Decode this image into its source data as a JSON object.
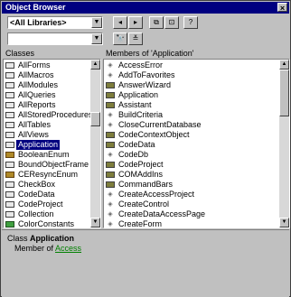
{
  "window": {
    "title": "Object Browser",
    "close_glyph": "×"
  },
  "toolbar": {
    "library_value": "<All Libraries>",
    "search_value": "",
    "buttons": [
      {
        "name": "back-button",
        "glyph": "◂"
      },
      {
        "name": "forward-button",
        "glyph": "▸"
      },
      {
        "name": "copy-to-clipboard-button",
        "glyph": "⧉"
      },
      {
        "name": "view-definition-button",
        "glyph": "⊡"
      },
      {
        "name": "help-button",
        "glyph": "?"
      }
    ],
    "search_button_glyph": "🔭",
    "toggle_results_glyph": "≚"
  },
  "classes": {
    "header": "Classes",
    "items": [
      {
        "label": "AllForms",
        "icon": "class"
      },
      {
        "label": "AllMacros",
        "icon": "class"
      },
      {
        "label": "AllModules",
        "icon": "class"
      },
      {
        "label": "AllQueries",
        "icon": "class"
      },
      {
        "label": "AllReports",
        "icon": "class"
      },
      {
        "label": "AllStoredProcedures",
        "icon": "class"
      },
      {
        "label": "AllTables",
        "icon": "class"
      },
      {
        "label": "AllViews",
        "icon": "class"
      },
      {
        "label": "Application",
        "icon": "class",
        "selected": true
      },
      {
        "label": "BooleanEnum",
        "icon": "enum"
      },
      {
        "label": "BoundObjectFrame",
        "icon": "class"
      },
      {
        "label": "CEResyncEnum",
        "icon": "enum"
      },
      {
        "label": "CheckBox",
        "icon": "class"
      },
      {
        "label": "CodeData",
        "icon": "class"
      },
      {
        "label": "CodeProject",
        "icon": "class"
      },
      {
        "label": "Collection",
        "icon": "class"
      },
      {
        "label": "ColorConstants",
        "icon": "module"
      },
      {
        "label": "ComboBox",
        "icon": "class"
      }
    ]
  },
  "members": {
    "header": "Members of 'Application'",
    "items": [
      {
        "label": "AccessError",
        "icon": "method"
      },
      {
        "label": "AddToFavorites",
        "icon": "method"
      },
      {
        "label": "AnswerWizard",
        "icon": "property"
      },
      {
        "label": "Application",
        "icon": "property"
      },
      {
        "label": "Assistant",
        "icon": "property"
      },
      {
        "label": "BuildCriteria",
        "icon": "method"
      },
      {
        "label": "CloseCurrentDatabase",
        "icon": "method"
      },
      {
        "label": "CodeContextObject",
        "icon": "property"
      },
      {
        "label": "CodeData",
        "icon": "property"
      },
      {
        "label": "CodeDb",
        "icon": "method"
      },
      {
        "label": "CodeProject",
        "icon": "property"
      },
      {
        "label": "COMAddIns",
        "icon": "property"
      },
      {
        "label": "CommandBars",
        "icon": "property"
      },
      {
        "label": "CreateAccessProject",
        "icon": "method"
      },
      {
        "label": "CreateControl",
        "icon": "method"
      },
      {
        "label": "CreateDataAccessPage",
        "icon": "method"
      },
      {
        "label": "CreateForm",
        "icon": "method"
      },
      {
        "label": "CreateGroupLevel",
        "icon": "method"
      }
    ]
  },
  "details": {
    "line1_prefix": "Class ",
    "line1_name": "Application",
    "line2_prefix": "Member of ",
    "line2_link": "Access"
  },
  "scroll": {
    "up": "▲",
    "down": "▼"
  }
}
